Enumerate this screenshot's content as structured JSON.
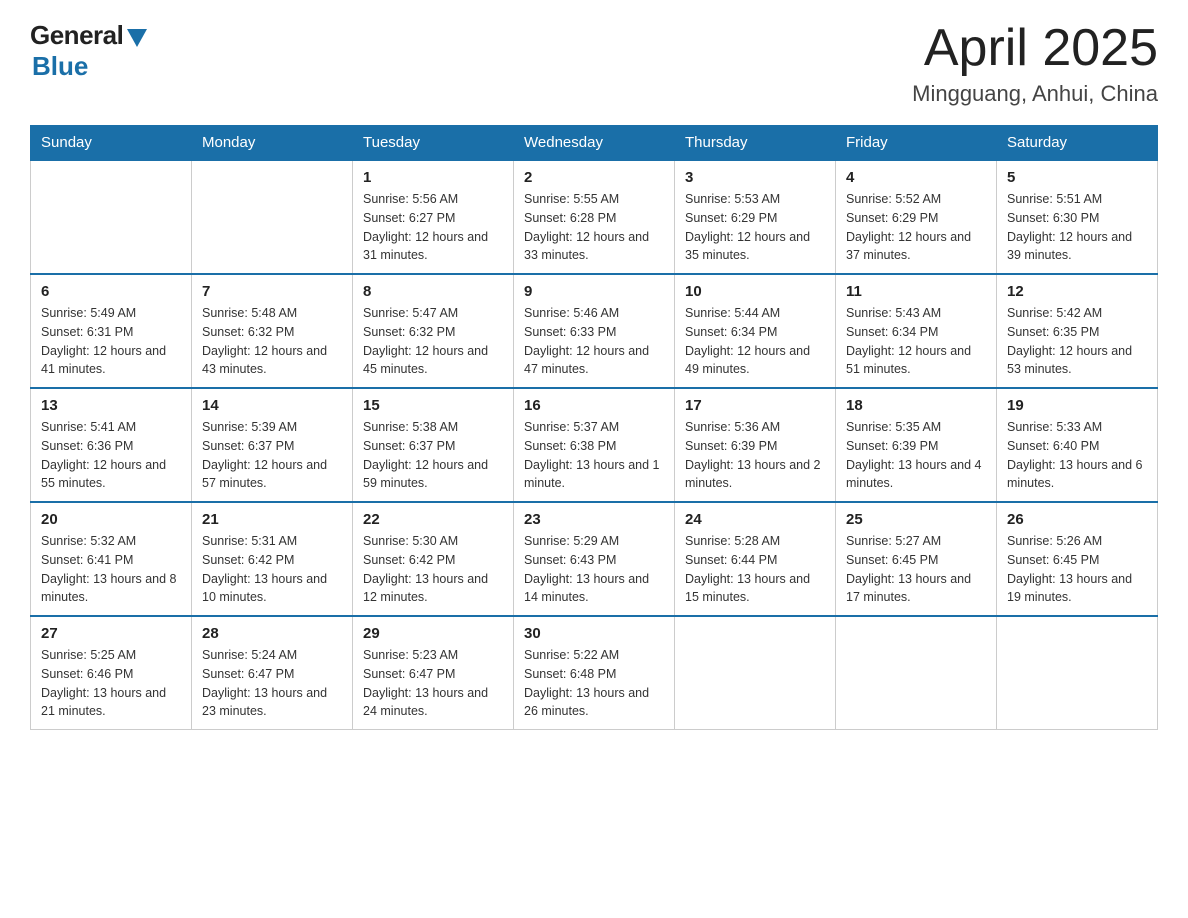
{
  "header": {
    "logo_general": "General",
    "logo_blue": "Blue",
    "title": "April 2025",
    "location": "Mingguang, Anhui, China"
  },
  "days_of_week": [
    "Sunday",
    "Monday",
    "Tuesday",
    "Wednesday",
    "Thursday",
    "Friday",
    "Saturday"
  ],
  "weeks": [
    [
      {
        "day": "",
        "info": ""
      },
      {
        "day": "",
        "info": ""
      },
      {
        "day": "1",
        "info": "Sunrise: 5:56 AM\nSunset: 6:27 PM\nDaylight: 12 hours\nand 31 minutes."
      },
      {
        "day": "2",
        "info": "Sunrise: 5:55 AM\nSunset: 6:28 PM\nDaylight: 12 hours\nand 33 minutes."
      },
      {
        "day": "3",
        "info": "Sunrise: 5:53 AM\nSunset: 6:29 PM\nDaylight: 12 hours\nand 35 minutes."
      },
      {
        "day": "4",
        "info": "Sunrise: 5:52 AM\nSunset: 6:29 PM\nDaylight: 12 hours\nand 37 minutes."
      },
      {
        "day": "5",
        "info": "Sunrise: 5:51 AM\nSunset: 6:30 PM\nDaylight: 12 hours\nand 39 minutes."
      }
    ],
    [
      {
        "day": "6",
        "info": "Sunrise: 5:49 AM\nSunset: 6:31 PM\nDaylight: 12 hours\nand 41 minutes."
      },
      {
        "day": "7",
        "info": "Sunrise: 5:48 AM\nSunset: 6:32 PM\nDaylight: 12 hours\nand 43 minutes."
      },
      {
        "day": "8",
        "info": "Sunrise: 5:47 AM\nSunset: 6:32 PM\nDaylight: 12 hours\nand 45 minutes."
      },
      {
        "day": "9",
        "info": "Sunrise: 5:46 AM\nSunset: 6:33 PM\nDaylight: 12 hours\nand 47 minutes."
      },
      {
        "day": "10",
        "info": "Sunrise: 5:44 AM\nSunset: 6:34 PM\nDaylight: 12 hours\nand 49 minutes."
      },
      {
        "day": "11",
        "info": "Sunrise: 5:43 AM\nSunset: 6:34 PM\nDaylight: 12 hours\nand 51 minutes."
      },
      {
        "day": "12",
        "info": "Sunrise: 5:42 AM\nSunset: 6:35 PM\nDaylight: 12 hours\nand 53 minutes."
      }
    ],
    [
      {
        "day": "13",
        "info": "Sunrise: 5:41 AM\nSunset: 6:36 PM\nDaylight: 12 hours\nand 55 minutes."
      },
      {
        "day": "14",
        "info": "Sunrise: 5:39 AM\nSunset: 6:37 PM\nDaylight: 12 hours\nand 57 minutes."
      },
      {
        "day": "15",
        "info": "Sunrise: 5:38 AM\nSunset: 6:37 PM\nDaylight: 12 hours\nand 59 minutes."
      },
      {
        "day": "16",
        "info": "Sunrise: 5:37 AM\nSunset: 6:38 PM\nDaylight: 13 hours\nand 1 minute."
      },
      {
        "day": "17",
        "info": "Sunrise: 5:36 AM\nSunset: 6:39 PM\nDaylight: 13 hours\nand 2 minutes."
      },
      {
        "day": "18",
        "info": "Sunrise: 5:35 AM\nSunset: 6:39 PM\nDaylight: 13 hours\nand 4 minutes."
      },
      {
        "day": "19",
        "info": "Sunrise: 5:33 AM\nSunset: 6:40 PM\nDaylight: 13 hours\nand 6 minutes."
      }
    ],
    [
      {
        "day": "20",
        "info": "Sunrise: 5:32 AM\nSunset: 6:41 PM\nDaylight: 13 hours\nand 8 minutes."
      },
      {
        "day": "21",
        "info": "Sunrise: 5:31 AM\nSunset: 6:42 PM\nDaylight: 13 hours\nand 10 minutes."
      },
      {
        "day": "22",
        "info": "Sunrise: 5:30 AM\nSunset: 6:42 PM\nDaylight: 13 hours\nand 12 minutes."
      },
      {
        "day": "23",
        "info": "Sunrise: 5:29 AM\nSunset: 6:43 PM\nDaylight: 13 hours\nand 14 minutes."
      },
      {
        "day": "24",
        "info": "Sunrise: 5:28 AM\nSunset: 6:44 PM\nDaylight: 13 hours\nand 15 minutes."
      },
      {
        "day": "25",
        "info": "Sunrise: 5:27 AM\nSunset: 6:45 PM\nDaylight: 13 hours\nand 17 minutes."
      },
      {
        "day": "26",
        "info": "Sunrise: 5:26 AM\nSunset: 6:45 PM\nDaylight: 13 hours\nand 19 minutes."
      }
    ],
    [
      {
        "day": "27",
        "info": "Sunrise: 5:25 AM\nSunset: 6:46 PM\nDaylight: 13 hours\nand 21 minutes."
      },
      {
        "day": "28",
        "info": "Sunrise: 5:24 AM\nSunset: 6:47 PM\nDaylight: 13 hours\nand 23 minutes."
      },
      {
        "day": "29",
        "info": "Sunrise: 5:23 AM\nSunset: 6:47 PM\nDaylight: 13 hours\nand 24 minutes."
      },
      {
        "day": "30",
        "info": "Sunrise: 5:22 AM\nSunset: 6:48 PM\nDaylight: 13 hours\nand 26 minutes."
      },
      {
        "day": "",
        "info": ""
      },
      {
        "day": "",
        "info": ""
      },
      {
        "day": "",
        "info": ""
      }
    ]
  ]
}
